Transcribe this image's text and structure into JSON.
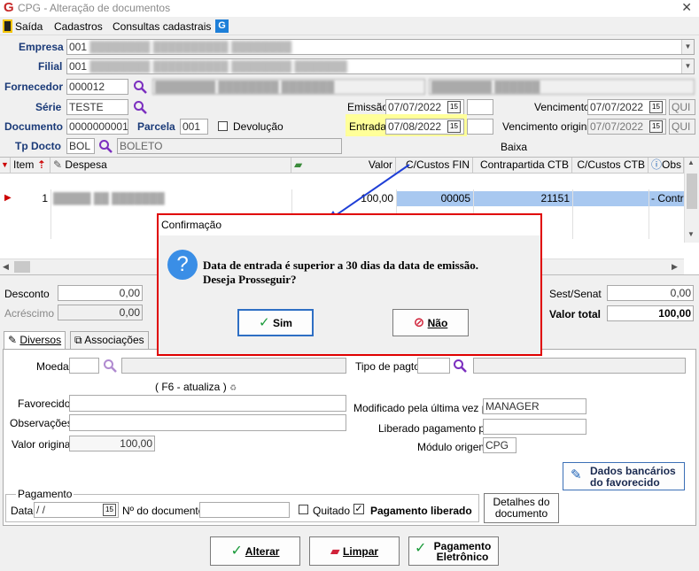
{
  "window": {
    "title": "CPG - Alteração de documentos",
    "close_glyph": "✕"
  },
  "menu": {
    "saida": "Saída",
    "cadastros": "Cadastros",
    "consultas": "Consultas cadastrais",
    "help_icon_letter": "G"
  },
  "header": {
    "empresa_label": "Empresa",
    "empresa_value": "001",
    "filial_label": "Filial",
    "filial_value": "001",
    "fornecedor_label": "Fornecedor",
    "fornecedor_value": "000012",
    "serie_label": "Série",
    "serie_value": "TESTE",
    "documento_label": "Documento",
    "documento_value": "0000000001",
    "parcela_label": "Parcela",
    "parcela_value": "001",
    "devolucao_label": "Devolução",
    "tpdocto_label": "Tp Docto",
    "tpdocto_value": "BOL",
    "tpdocto_desc": "BOLETO",
    "emissao_label": "Emissão",
    "emissao_value": "07/07/2022",
    "entrada_label": "Entrada",
    "entrada_value": "07/08/2022",
    "vencimento_label": "Vencimento",
    "vencimento_value": "07/07/2022",
    "vencimento_day": "QUI",
    "venc_original_label": "Vencimento original",
    "venc_original_value": "07/07/2022",
    "venc_original_day": "QUI",
    "baixa_label": "Baixa",
    "cal_glyph": "15"
  },
  "grid": {
    "columns": [
      "Item",
      "Despesa",
      "Valor",
      "C/Custos FIN",
      "Contrapartida CTB",
      "C/Custos CTB",
      "Obs"
    ],
    "row": {
      "item": "1",
      "valor": "100,00",
      "ccfin": "00005",
      "contrapartida": "21151",
      "obs": "- Contra"
    }
  },
  "totals": {
    "desconto_label": "Desconto",
    "desconto_value": "0,00",
    "acrescimo_label": "Acréscimo",
    "acrescimo_value": "0,00",
    "sestsenat_label": "Sest/Senat",
    "sestsenat_value": "0,00",
    "valortotal_label": "Valor total",
    "valortotal_value": "100,00"
  },
  "tabs": {
    "diversos": "Diversos",
    "associacoes": "Associações"
  },
  "diversos": {
    "moeda_label": "Moeda",
    "f6_hint": "( F6 - atualiza )",
    "tipopagto_label": "Tipo de pagto",
    "favorecido_label": "Favorecido",
    "observacoes_label": "Observações",
    "valororiginal_label": "Valor original",
    "valororiginal_value": "100,00",
    "modificado_label": "Modificado pela última vez por",
    "modificado_value": "MANAGER",
    "liberado_label": "Liberado pagamento por",
    "modulo_label": "Módulo origem",
    "modulo_value": "CPG",
    "dados_bancarios_line1": "Dados bancários",
    "dados_bancarios_line2": "do favorecido",
    "pagamento_legend": "Pagamento",
    "data_label": "Data",
    "data_value": " / /",
    "ndoc_label": "Nº do documento",
    "quitado_label": "Quitado",
    "pagliberado_label": "Pagamento liberado",
    "detalhes_line1": "Detalhes do",
    "detalhes_line2": "documento"
  },
  "footer": {
    "alterar": "Alterar",
    "limpar": "Limpar",
    "pagamento_line1": "Pagamento",
    "pagamento_line2": "Eletrônico"
  },
  "dialog": {
    "title": "Confirmação",
    "message": "Data de entrada é superior a 30 dias da data de emissão. Deseja Prosseguir?",
    "question_glyph": "?",
    "sim": "Sim",
    "nao": "Não"
  },
  "colors": {
    "highlight": "#ffff99",
    "selected_row": "#a8c8f0",
    "dialog_border": "#e00000",
    "accent_purple": "#7b2fbf"
  }
}
